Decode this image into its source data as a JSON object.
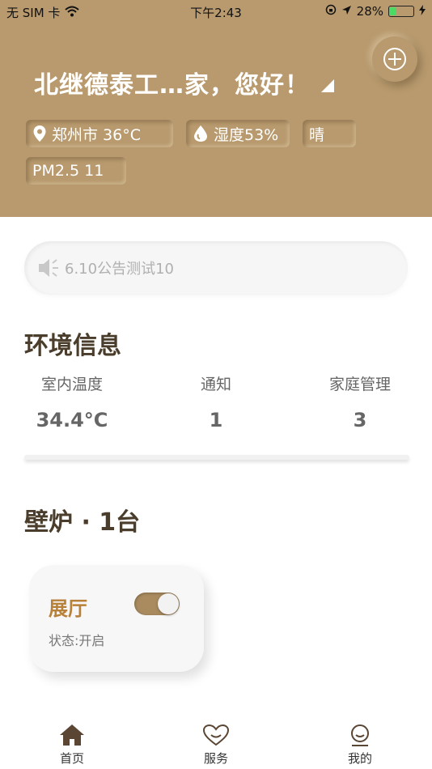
{
  "status_bar": {
    "carrier": "无 SIM 卡",
    "time": "下午2:43",
    "battery": "28%",
    "battery_level": 0.28
  },
  "header": {
    "greeting": "北继德泰工…家，您好！",
    "add_icon": "plus-circle-icon",
    "chips": {
      "location": "郑州市 36°C",
      "humidity": "湿度53%",
      "weather": "晴",
      "pm25": "PM2.5 11"
    }
  },
  "notice": {
    "text": "6.10公告测试10",
    "icon": "speaker-icon"
  },
  "environment": {
    "title": "环境信息",
    "items": [
      {
        "label": "室内温度",
        "value": "34.4°C"
      },
      {
        "label": "通知",
        "value": "1"
      },
      {
        "label": "家庭管理",
        "value": "3"
      }
    ]
  },
  "fireplace": {
    "title": "壁炉 · 1台",
    "devices": [
      {
        "name": "展厅",
        "state": "状态:开启",
        "on": true
      }
    ]
  },
  "tabbar": {
    "items": [
      {
        "label": "首页",
        "icon": "home-icon",
        "active": true
      },
      {
        "label": "服务",
        "icon": "heart-icon",
        "active": false
      },
      {
        "label": "我的",
        "icon": "user-icon",
        "active": false
      }
    ]
  },
  "colors": {
    "header_bg": "#b89a6e",
    "accent": "#b8813a",
    "toggle_on": "#a98b5f"
  }
}
